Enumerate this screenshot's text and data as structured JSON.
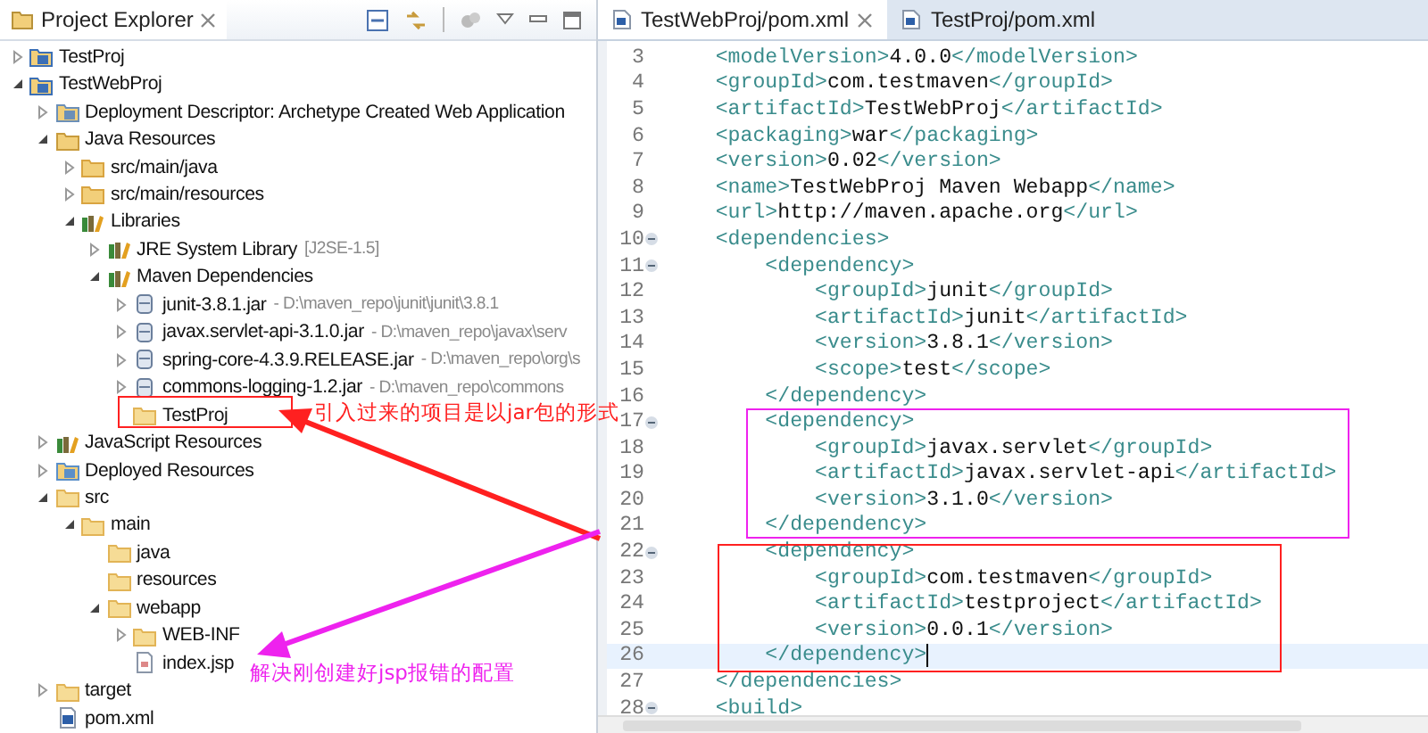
{
  "explorer": {
    "title": "Project Explorer",
    "tree": [
      {
        "label": "TestProj",
        "kind": "project",
        "expanded": false
      },
      {
        "label": "TestWebProj",
        "kind": "project",
        "expanded": true,
        "children": [
          {
            "label": "Deployment Descriptor: Archetype Created Web Application",
            "kind": "descriptor",
            "expanded": false
          },
          {
            "label": "Java Resources",
            "kind": "resources",
            "expanded": true,
            "children": [
              {
                "label": "src/main/java",
                "kind": "source-folder",
                "expanded": false
              },
              {
                "label": "src/main/resources",
                "kind": "source-folder",
                "expanded": false
              },
              {
                "label": "Libraries",
                "kind": "library",
                "expanded": true,
                "children": [
                  {
                    "label": "JRE System Library",
                    "decoration": "[J2SE-1.5]",
                    "kind": "library",
                    "expanded": false
                  },
                  {
                    "label": "Maven Dependencies",
                    "kind": "library",
                    "expanded": true,
                    "children": [
                      {
                        "label": "junit-3.8.1.jar",
                        "decoration": "- D:\\maven_repo\\junit\\junit\\3.8.1",
                        "kind": "jar",
                        "expanded": false
                      },
                      {
                        "label": "javax.servlet-api-3.1.0.jar",
                        "decoration": "- D:\\maven_repo\\javax\\serv",
                        "kind": "jar",
                        "expanded": false
                      },
                      {
                        "label": "spring-core-4.3.9.RELEASE.jar",
                        "decoration": "- D:\\maven_repo\\org\\s",
                        "kind": "jar",
                        "expanded": false
                      },
                      {
                        "label": "commons-logging-1.2.jar",
                        "decoration": "- D:\\maven_repo\\commons",
                        "kind": "jar",
                        "expanded": false
                      },
                      {
                        "label": "TestProj",
                        "kind": "folder"
                      }
                    ]
                  }
                ]
              }
            ]
          },
          {
            "label": "JavaScript Resources",
            "kind": "library",
            "expanded": false
          },
          {
            "label": "Deployed Resources",
            "kind": "deployed",
            "expanded": false
          },
          {
            "label": "src",
            "kind": "folder",
            "expanded": true,
            "children": [
              {
                "label": "main",
                "kind": "folder",
                "expanded": true,
                "children": [
                  {
                    "label": "java",
                    "kind": "folder"
                  },
                  {
                    "label": "resources",
                    "kind": "folder"
                  },
                  {
                    "label": "webapp",
                    "kind": "folder",
                    "expanded": true,
                    "children": [
                      {
                        "label": "WEB-INF",
                        "kind": "folder",
                        "expanded": false
                      },
                      {
                        "label": "index.jsp",
                        "kind": "file"
                      }
                    ]
                  }
                ]
              }
            ]
          },
          {
            "label": "target",
            "kind": "folder",
            "expanded": false
          },
          {
            "label": "pom.xml",
            "kind": "maven-file"
          }
        ]
      }
    ]
  },
  "editor": {
    "tabs": [
      {
        "label": "TestWebProj/pom.xml",
        "selected": true
      },
      {
        "label": "TestProj/pom.xml",
        "selected": false
      }
    ],
    "lines": [
      {
        "number": "3",
        "text": "    <modelVersion>4.0.0</modelVersion>",
        "fold": false,
        "current": false
      },
      {
        "number": "4",
        "text": "    <groupId>com.testmaven</groupId>",
        "fold": false,
        "current": false
      },
      {
        "number": "5",
        "text": "    <artifactId>TestWebProj</artifactId>",
        "fold": false,
        "current": false
      },
      {
        "number": "6",
        "text": "    <packaging>war</packaging>",
        "fold": false,
        "current": false
      },
      {
        "number": "7",
        "text": "    <version>0.02</version>",
        "fold": false,
        "current": false
      },
      {
        "number": "8",
        "text": "    <name>TestWebProj Maven Webapp</name>",
        "fold": false,
        "current": false
      },
      {
        "number": "9",
        "text": "    <url>http://maven.apache.org</url>",
        "fold": false,
        "current": false
      },
      {
        "number": "10",
        "text": "    <dependencies>",
        "fold": true,
        "current": false
      },
      {
        "number": "11",
        "text": "        <dependency>",
        "fold": true,
        "current": false
      },
      {
        "number": "12",
        "text": "            <groupId>junit</groupId>",
        "fold": false,
        "current": false
      },
      {
        "number": "13",
        "text": "            <artifactId>junit</artifactId>",
        "fold": false,
        "current": false
      },
      {
        "number": "14",
        "text": "            <version>3.8.1</version>",
        "fold": false,
        "current": false
      },
      {
        "number": "15",
        "text": "            <scope>test</scope>",
        "fold": false,
        "current": false
      },
      {
        "number": "16",
        "text": "        </dependency>",
        "fold": false,
        "current": false
      },
      {
        "number": "17",
        "text": "        <dependency>",
        "fold": true,
        "current": false
      },
      {
        "number": "18",
        "text": "            <groupId>javax.servlet</groupId>",
        "fold": false,
        "current": false
      },
      {
        "number": "19",
        "text": "            <artifactId>javax.servlet-api</artifactId>",
        "fold": false,
        "current": false
      },
      {
        "number": "20",
        "text": "            <version>3.1.0</version>",
        "fold": false,
        "current": false
      },
      {
        "number": "21",
        "text": "        </dependency>",
        "fold": false,
        "current": false
      },
      {
        "number": "22",
        "text": "        <dependency>",
        "fold": true,
        "current": false
      },
      {
        "number": "23",
        "text": "            <groupId>com.testmaven</groupId>",
        "fold": false,
        "current": false
      },
      {
        "number": "24",
        "text": "            <artifactId>testproject</artifactId>",
        "fold": false,
        "current": false
      },
      {
        "number": "25",
        "text": "            <version>0.0.1</version>",
        "fold": false,
        "current": false
      },
      {
        "number": "26",
        "text": "        </dependency>",
        "fold": false,
        "current": true
      },
      {
        "number": "27",
        "text": "    </dependencies>",
        "fold": false,
        "current": false
      },
      {
        "number": "28",
        "text": "    <build>",
        "fold": true,
        "current": false
      }
    ]
  },
  "annotations": [
    {
      "text": "引入过来的项目是以jar包的形式",
      "color": "#ff2020"
    },
    {
      "text": "解决刚创建好jsp报错的配置",
      "color": "#ee22ee"
    }
  ]
}
